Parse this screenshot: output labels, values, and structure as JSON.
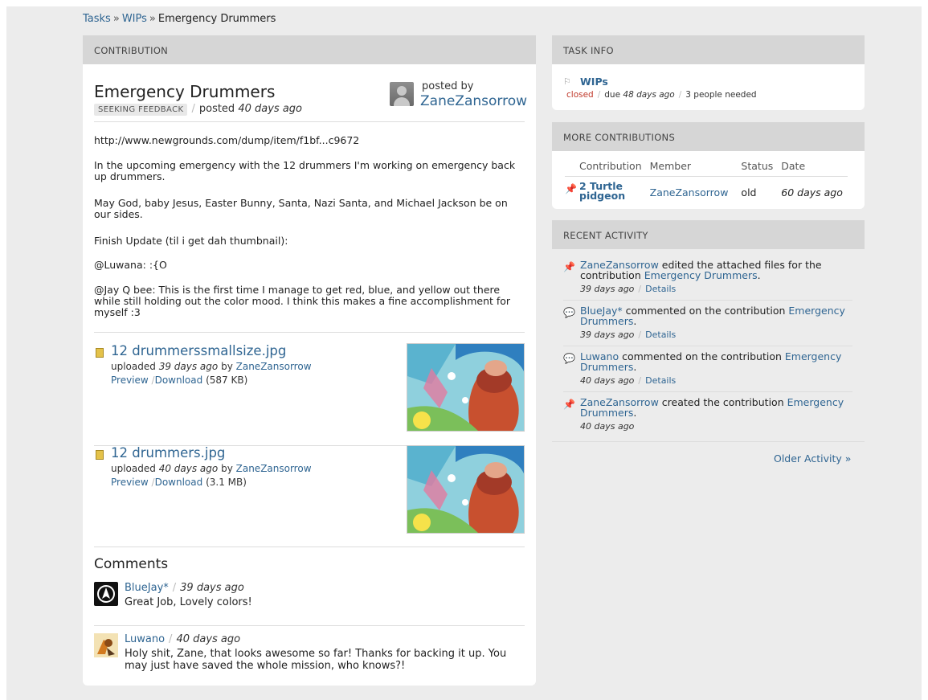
{
  "breadcrumb": {
    "items": [
      "Tasks",
      "WIPs",
      "Emergency Drummers"
    ],
    "sep": "»"
  },
  "contribution": {
    "header": "CONTRIBUTION",
    "title": "Emergency Drummers",
    "status_tag": "SEEKING FEEDBACK",
    "posted_prefix": "posted",
    "posted_when": "40 days ago",
    "posted_by_label": "posted by",
    "author": "ZaneZansorrow",
    "link": "http://www.newgrounds.com/dump/item/f1bf...c9672",
    "paragraphs": [
      "In the upcoming emergency with the 12 drummers I'm working on emergency back up drummers.",
      "May God, baby Jesus, Easter Bunny, Santa, Nazi Santa, and Michael Jackson be on our sides.",
      "Finish Update (til i get dah thumbnail):",
      "@Luwana: :{O",
      "@Jay Q bee: This is the first time I manage to get red, blue, and yellow out there while still holding out the color mood. I think this makes a fine accomplishment for myself :3"
    ],
    "files": [
      {
        "name": "12 drummerssmallsize.jpg",
        "uploaded_prefix": "uploaded",
        "when": "39 days ago",
        "by_prefix": "by",
        "by": "ZaneZansorrow",
        "preview": "Preview",
        "download": "Download",
        "size": "(587 KB)"
      },
      {
        "name": "12 drummers.jpg",
        "uploaded_prefix": "uploaded",
        "when": "40 days ago",
        "by_prefix": "by",
        "by": "ZaneZansorrow",
        "preview": "Preview",
        "download": "Download",
        "size": "(3.1 MB)"
      }
    ],
    "comments_title": "Comments",
    "comments": [
      {
        "user": "BlueJay*",
        "when": "39 days ago",
        "text": "Great Job, Lovely colors!"
      },
      {
        "user": "Luwano",
        "when": "40 days ago",
        "text": "Holy shit, Zane, that looks awesome so far! Thanks for backing it up. You may just have saved the whole mission, who knows?!"
      }
    ]
  },
  "task_info": {
    "header": "TASK INFO",
    "name": "WIPs",
    "status": "closed",
    "due_prefix": "due",
    "due": "48 days ago",
    "needed": "3 people needed",
    "status_color": "#c0392b"
  },
  "more_contributions": {
    "header": "MORE CONTRIBUTIONS",
    "columns": [
      "Contribution",
      "Member",
      "Status",
      "Date"
    ],
    "rows": [
      {
        "contribution": "2 Turtle pidgeon",
        "member": "ZaneZansorrow",
        "status": "old",
        "date": "60 days ago"
      }
    ]
  },
  "recent_activity": {
    "header": "RECENT ACTIVITY",
    "items": [
      {
        "icon": "pin-icon",
        "user": "ZaneZansorrow",
        "action": "edited the attached files for the contribution",
        "target": "Emergency Drummers",
        "when": "39 days ago",
        "details": "Details"
      },
      {
        "icon": "comment-icon",
        "user": "BlueJay*",
        "action": "commented on the contribution",
        "target": "Emergency Drummers",
        "when": "39 days ago",
        "details": "Details"
      },
      {
        "icon": "comment-icon",
        "user": "Luwano",
        "action": "commented on the contribution",
        "target": "Emergency Drummers",
        "when": "40 days ago",
        "details": "Details"
      },
      {
        "icon": "pin-add-icon",
        "user": "ZaneZansorrow",
        "action": "created the contribution",
        "target": "Emergency Drummers",
        "when": "40 days ago"
      }
    ],
    "older": "Older Activity »"
  },
  "colors": {
    "link": "#2f6592",
    "panel_header": "#d6d6d6",
    "background": "#ececec"
  }
}
